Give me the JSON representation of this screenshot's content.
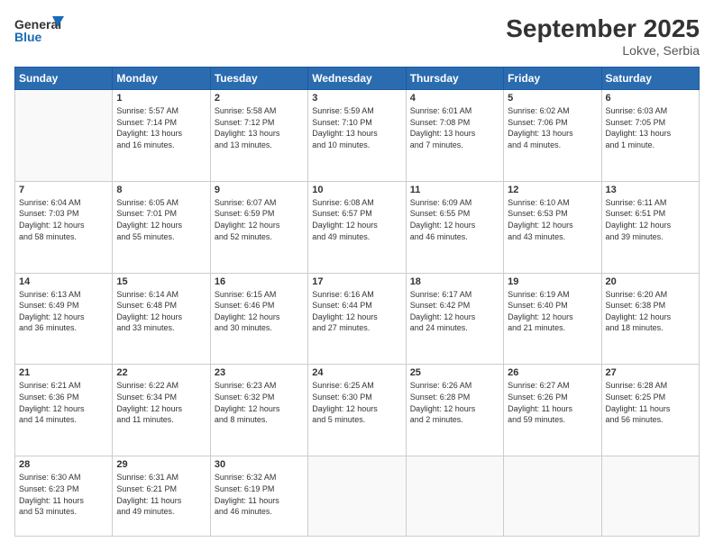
{
  "header": {
    "logo_line1": "General",
    "logo_line2": "Blue",
    "month_title": "September 2025",
    "location": "Lokve, Serbia"
  },
  "weekdays": [
    "Sunday",
    "Monday",
    "Tuesday",
    "Wednesday",
    "Thursday",
    "Friday",
    "Saturday"
  ],
  "weeks": [
    [
      {
        "day": "",
        "info": ""
      },
      {
        "day": "1",
        "info": "Sunrise: 5:57 AM\nSunset: 7:14 PM\nDaylight: 13 hours\nand 16 minutes."
      },
      {
        "day": "2",
        "info": "Sunrise: 5:58 AM\nSunset: 7:12 PM\nDaylight: 13 hours\nand 13 minutes."
      },
      {
        "day": "3",
        "info": "Sunrise: 5:59 AM\nSunset: 7:10 PM\nDaylight: 13 hours\nand 10 minutes."
      },
      {
        "day": "4",
        "info": "Sunrise: 6:01 AM\nSunset: 7:08 PM\nDaylight: 13 hours\nand 7 minutes."
      },
      {
        "day": "5",
        "info": "Sunrise: 6:02 AM\nSunset: 7:06 PM\nDaylight: 13 hours\nand 4 minutes."
      },
      {
        "day": "6",
        "info": "Sunrise: 6:03 AM\nSunset: 7:05 PM\nDaylight: 13 hours\nand 1 minute."
      }
    ],
    [
      {
        "day": "7",
        "info": "Sunrise: 6:04 AM\nSunset: 7:03 PM\nDaylight: 12 hours\nand 58 minutes."
      },
      {
        "day": "8",
        "info": "Sunrise: 6:05 AM\nSunset: 7:01 PM\nDaylight: 12 hours\nand 55 minutes."
      },
      {
        "day": "9",
        "info": "Sunrise: 6:07 AM\nSunset: 6:59 PM\nDaylight: 12 hours\nand 52 minutes."
      },
      {
        "day": "10",
        "info": "Sunrise: 6:08 AM\nSunset: 6:57 PM\nDaylight: 12 hours\nand 49 minutes."
      },
      {
        "day": "11",
        "info": "Sunrise: 6:09 AM\nSunset: 6:55 PM\nDaylight: 12 hours\nand 46 minutes."
      },
      {
        "day": "12",
        "info": "Sunrise: 6:10 AM\nSunset: 6:53 PM\nDaylight: 12 hours\nand 43 minutes."
      },
      {
        "day": "13",
        "info": "Sunrise: 6:11 AM\nSunset: 6:51 PM\nDaylight: 12 hours\nand 39 minutes."
      }
    ],
    [
      {
        "day": "14",
        "info": "Sunrise: 6:13 AM\nSunset: 6:49 PM\nDaylight: 12 hours\nand 36 minutes."
      },
      {
        "day": "15",
        "info": "Sunrise: 6:14 AM\nSunset: 6:48 PM\nDaylight: 12 hours\nand 33 minutes."
      },
      {
        "day": "16",
        "info": "Sunrise: 6:15 AM\nSunset: 6:46 PM\nDaylight: 12 hours\nand 30 minutes."
      },
      {
        "day": "17",
        "info": "Sunrise: 6:16 AM\nSunset: 6:44 PM\nDaylight: 12 hours\nand 27 minutes."
      },
      {
        "day": "18",
        "info": "Sunrise: 6:17 AM\nSunset: 6:42 PM\nDaylight: 12 hours\nand 24 minutes."
      },
      {
        "day": "19",
        "info": "Sunrise: 6:19 AM\nSunset: 6:40 PM\nDaylight: 12 hours\nand 21 minutes."
      },
      {
        "day": "20",
        "info": "Sunrise: 6:20 AM\nSunset: 6:38 PM\nDaylight: 12 hours\nand 18 minutes."
      }
    ],
    [
      {
        "day": "21",
        "info": "Sunrise: 6:21 AM\nSunset: 6:36 PM\nDaylight: 12 hours\nand 14 minutes."
      },
      {
        "day": "22",
        "info": "Sunrise: 6:22 AM\nSunset: 6:34 PM\nDaylight: 12 hours\nand 11 minutes."
      },
      {
        "day": "23",
        "info": "Sunrise: 6:23 AM\nSunset: 6:32 PM\nDaylight: 12 hours\nand 8 minutes."
      },
      {
        "day": "24",
        "info": "Sunrise: 6:25 AM\nSunset: 6:30 PM\nDaylight: 12 hours\nand 5 minutes."
      },
      {
        "day": "25",
        "info": "Sunrise: 6:26 AM\nSunset: 6:28 PM\nDaylight: 12 hours\nand 2 minutes."
      },
      {
        "day": "26",
        "info": "Sunrise: 6:27 AM\nSunset: 6:26 PM\nDaylight: 11 hours\nand 59 minutes."
      },
      {
        "day": "27",
        "info": "Sunrise: 6:28 AM\nSunset: 6:25 PM\nDaylight: 11 hours\nand 56 minutes."
      }
    ],
    [
      {
        "day": "28",
        "info": "Sunrise: 6:30 AM\nSunset: 6:23 PM\nDaylight: 11 hours\nand 53 minutes."
      },
      {
        "day": "29",
        "info": "Sunrise: 6:31 AM\nSunset: 6:21 PM\nDaylight: 11 hours\nand 49 minutes."
      },
      {
        "day": "30",
        "info": "Sunrise: 6:32 AM\nSunset: 6:19 PM\nDaylight: 11 hours\nand 46 minutes."
      },
      {
        "day": "",
        "info": ""
      },
      {
        "day": "",
        "info": ""
      },
      {
        "day": "",
        "info": ""
      },
      {
        "day": "",
        "info": ""
      }
    ]
  ]
}
